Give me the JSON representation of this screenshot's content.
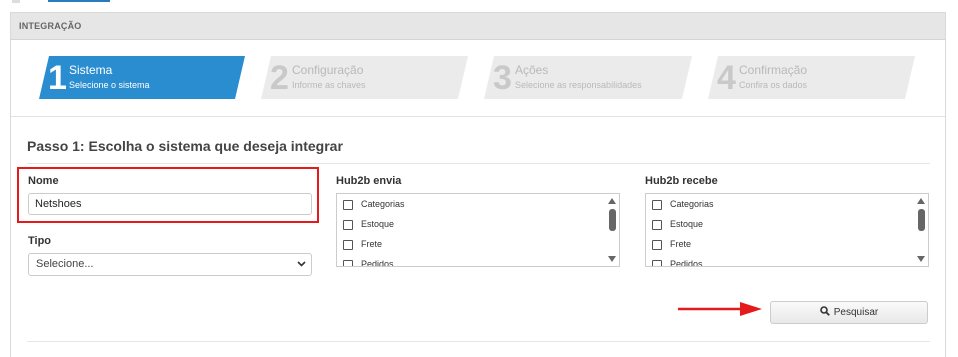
{
  "panel": {
    "header": "INTEGRAÇÃO"
  },
  "wizard": {
    "steps": [
      {
        "number": "1",
        "title": "Sistema",
        "subtitle": "Selecione o sistema",
        "active": true
      },
      {
        "number": "2",
        "title": "Configuração",
        "subtitle": "Informe as chaves",
        "active": false
      },
      {
        "number": "3",
        "title": "Ações",
        "subtitle": "Selecione as responsabilidades",
        "active": false
      },
      {
        "number": "4",
        "title": "Confirmação",
        "subtitle": "Confira os dados",
        "active": false
      }
    ],
    "active_color": "#2a8dd0",
    "inactive_color": "#ebebeb"
  },
  "form": {
    "section_title": "Passo 1: Escolha o sistema que deseja integrar",
    "nome": {
      "label": "Nome",
      "value": "Netshoes"
    },
    "tipo": {
      "label": "Tipo",
      "selected": "Selecione..."
    },
    "envia": {
      "label": "Hub2b envia",
      "options": [
        "Categorias",
        "Estoque",
        "Frete",
        "Pedidos"
      ]
    },
    "recebe": {
      "label": "Hub2b recebe",
      "options": [
        "Categorias",
        "Estoque",
        "Frete",
        "Pedidos"
      ]
    },
    "search_button": "Pesquisar"
  },
  "annotations": {
    "highlight_color": "#e51b1b",
    "arrow_color": "#e51b1b"
  }
}
